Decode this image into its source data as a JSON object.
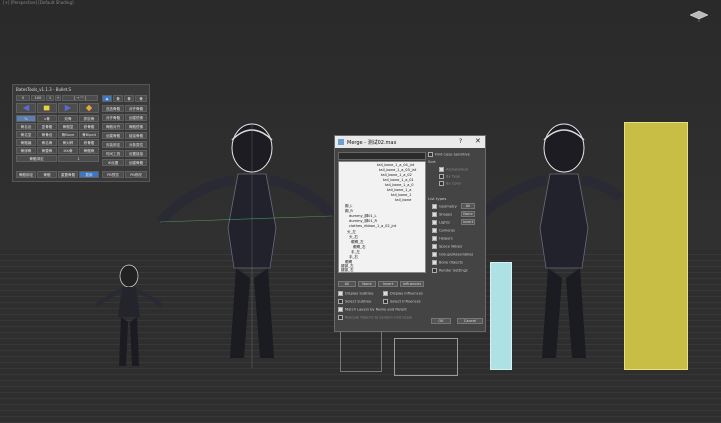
{
  "viewport": {
    "label": "[+] [Perspective] [Default Shading]"
  },
  "tools": {
    "title": "BatesTools_v1.1.3 - Bullet.S",
    "row1": [
      "0",
      "100",
      "1",
      "+",
      "[ → \"\" ]"
    ],
    "side_top": [
      "◆",
      "骨",
      "骨",
      "骨"
    ],
    "right_col": [
      "选选骨骼",
      "对齐骨骼",
      "骨骼对齐",
      "创建骨骼",
      "安装绑定",
      "时间工具",
      "IK设置",
      "PB预览"
    ],
    "right_col2": [
      "对齐骨骼",
      "创建镜像",
      "骨骼镜像",
      "链接骨骼",
      "对象属性",
      "设置链接",
      "创建骨骼",
      "PB修改"
    ],
    "grid": [
      [
        "%",
        "x骨",
        "双骨",
        "抓胶骨"
      ],
      [
        "骨名设",
        "显骨骼",
        "骨骼显",
        "修骨骼"
      ],
      [
        "骨名显",
        "骨骨设",
        "骨Bone",
        "骨Biped"
      ],
      [
        "骨骼编",
        "骨名骨",
        "骨对称",
        "修骨骼"
      ],
      [
        "骨绑骨",
        "骨替骨",
        "IKk骨",
        "骨骼骨"
      ],
      [
        "骨骼绑定",
        "1"
      ],
      [
        "骨骼绑定",
        "骨绑",
        "重置骨骼",
        "骨骼"
      ]
    ],
    "bottom": [
      "骨骼绑定",
      "骨骼",
      "重置骨骼",
      "更新"
    ]
  },
  "dialog": {
    "title": "Merge - 测试02.max",
    "help": "?",
    "close": "✕",
    "list_items": [
      "tail_bone_1_a_04_jnt",
      "tail_bone_1_a_03_jnt",
      "tail_bone_1_a_02",
      "tail_bone_1_a_01",
      "tail_bone_1_a_0",
      "tail_bone_1_a",
      "tail_bone_1",
      "tail_bone",
      "脚_L",
      "脚_R",
      "dummy_脚01_L",
      "dummy_脚01_R",
      "clothes_ribbon_1_a_02_jnt",
      "头_左",
      "头_右",
      "眼睛_左",
      "眼睛_右",
      "手_左",
      "手_右",
      "眼睛",
      "腿部_左",
      "腿部_右",
      "腿部"
    ],
    "list_buttons": [
      "All",
      "None",
      "Invert",
      "Influences"
    ],
    "checks_left": [
      {
        "label": "Display Subtree",
        "on": true
      },
      {
        "label": "Select Subtree",
        "on": false
      },
      {
        "label": "Match Layers by Name and Parent",
        "on": true
      },
      {
        "label": "Rescale Objects to System Unit Scale",
        "on": false
      }
    ],
    "checks_right": [
      {
        "label": "Display Influences",
        "on": true
      },
      {
        "label": "Select Influences",
        "on": false
      }
    ],
    "find_case": "Find Case Sensitive",
    "sort_label": "Sort",
    "sort_options": [
      "Alphabetical",
      "By Type",
      "By Color"
    ],
    "list_types_label": "List types",
    "list_types": [
      "Geometry",
      "Shapes",
      "Lights",
      "Cameras",
      "Helpers",
      "Space Warps",
      "Groups/Assemblies",
      "Bone Objects",
      "Render Settings"
    ],
    "type_buttons": [
      "All",
      "None",
      "Invert"
    ],
    "ok": "OK",
    "cancel": "Cancel"
  },
  "colors": {
    "accent": "#3b78c4",
    "yellow_box": "#c8bd45",
    "teal_box": "#aee1e3"
  }
}
